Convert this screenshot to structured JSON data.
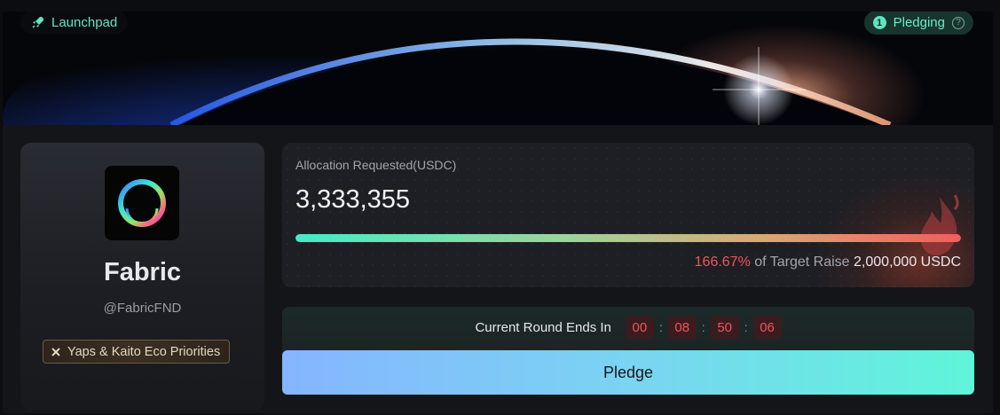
{
  "header": {
    "launchpad_label": "Launchpad",
    "status": {
      "step": "1",
      "label": "Pledging",
      "help": "?"
    }
  },
  "project": {
    "name": "Fabric",
    "handle": "@FabricFND",
    "tag": "Yaps & Kaito Eco Priorities"
  },
  "allocation": {
    "label": "Allocation Requested(USDC)",
    "value": "3,333,355",
    "progress_fraction": 1.0,
    "percent": "166.67%",
    "target_text": " of Target Raise ",
    "target_amount": "2,000,000 USDC"
  },
  "round": {
    "label": "Current Round Ends In",
    "days": "00",
    "hours": "08",
    "minutes": "50",
    "seconds": "06",
    "sep": ":"
  },
  "actions": {
    "pledge_label": "Pledge"
  },
  "colors": {
    "accent": "#5fe6c8",
    "danger": "#f0545c",
    "button_start": "#85b5ff",
    "button_end": "#5ff5d9"
  }
}
